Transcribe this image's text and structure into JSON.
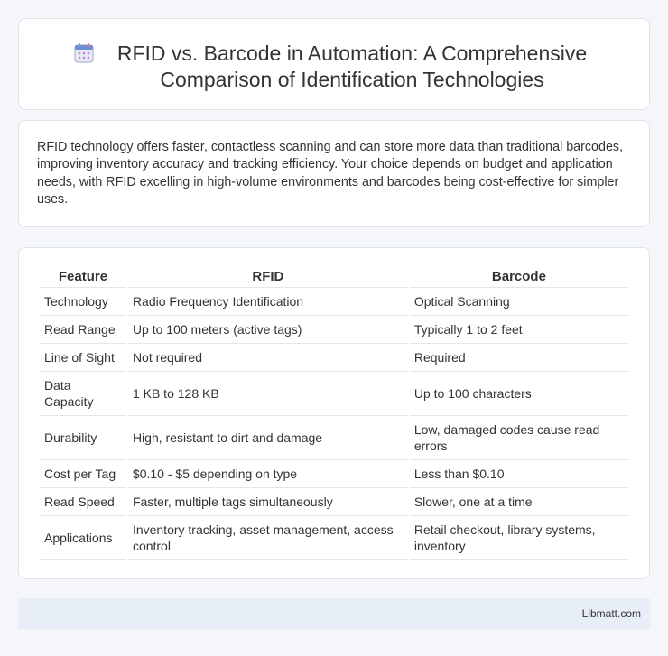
{
  "header": {
    "title": "RFID vs. Barcode in Automation: A Comprehensive Comparison of Identification Technologies",
    "icon": "calendar-icon"
  },
  "summary": {
    "text": "RFID technology offers faster, contactless scanning and can store more data than traditional barcodes, improving inventory accuracy and tracking efficiency. Your choice depends on budget and application needs, with RFID excelling in high-volume environments and barcodes being cost-effective for simpler uses."
  },
  "table": {
    "headers": [
      "Feature",
      "RFID",
      "Barcode"
    ],
    "rows": [
      [
        "Technology",
        "Radio Frequency Identification",
        "Optical Scanning"
      ],
      [
        "Read Range",
        "Up to 100 meters (active tags)",
        "Typically 1 to 2 feet"
      ],
      [
        "Line of Sight",
        "Not required",
        "Required"
      ],
      [
        "Data Capacity",
        "1 KB to 128 KB",
        "Up to 100 characters"
      ],
      [
        "Durability",
        "High, resistant to dirt and damage",
        "Low, damaged codes cause read errors"
      ],
      [
        "Cost per Tag",
        "$0.10 - $5 depending on type",
        "Less than $0.10"
      ],
      [
        "Read Speed",
        "Faster, multiple tags simultaneously",
        "Slower, one at a time"
      ],
      [
        "Applications",
        "Inventory tracking, asset management, access control",
        "Retail checkout, library systems, inventory"
      ]
    ]
  },
  "footer": {
    "text": "Libmatt.com"
  }
}
